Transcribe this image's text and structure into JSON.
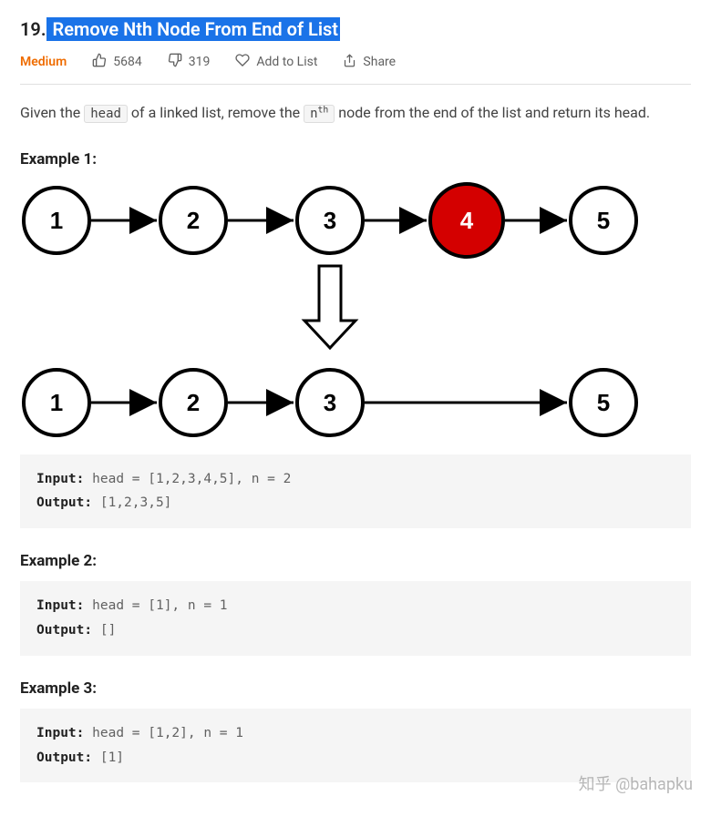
{
  "title": {
    "number": "19.",
    "name": " Remove Nth Node From End of List"
  },
  "meta": {
    "difficulty": "Medium",
    "likes": "5684",
    "dislikes": "319",
    "addToList": "Add to List",
    "share": "Share"
  },
  "description": {
    "pre": "Given the ",
    "code1": "head",
    "mid": " of a linked list, remove the ",
    "code2_base": "n",
    "code2_sup": "th",
    "post": " node from the end of the list and return its head."
  },
  "examples": [
    {
      "label": "Example 1:",
      "diagram": {
        "top": [
          {
            "v": "1"
          },
          {
            "v": "2"
          },
          {
            "v": "3"
          },
          {
            "v": "4",
            "hl": true
          },
          {
            "v": "5"
          }
        ],
        "bottom": [
          {
            "v": "1"
          },
          {
            "v": "2"
          },
          {
            "v": "3"
          },
          {
            "v": "5",
            "skip": true
          }
        ]
      },
      "input": "head = [1,2,3,4,5], n = 2",
      "output": "[1,2,3,5]"
    },
    {
      "label": "Example 2:",
      "input": "head = [1], n = 1",
      "output": "[]"
    },
    {
      "label": "Example 3:",
      "input": "head = [1,2], n = 1",
      "output": "[1]"
    }
  ],
  "labels": {
    "input": "Input:",
    "output": "Output:"
  },
  "watermark": "知乎 @bahapku"
}
